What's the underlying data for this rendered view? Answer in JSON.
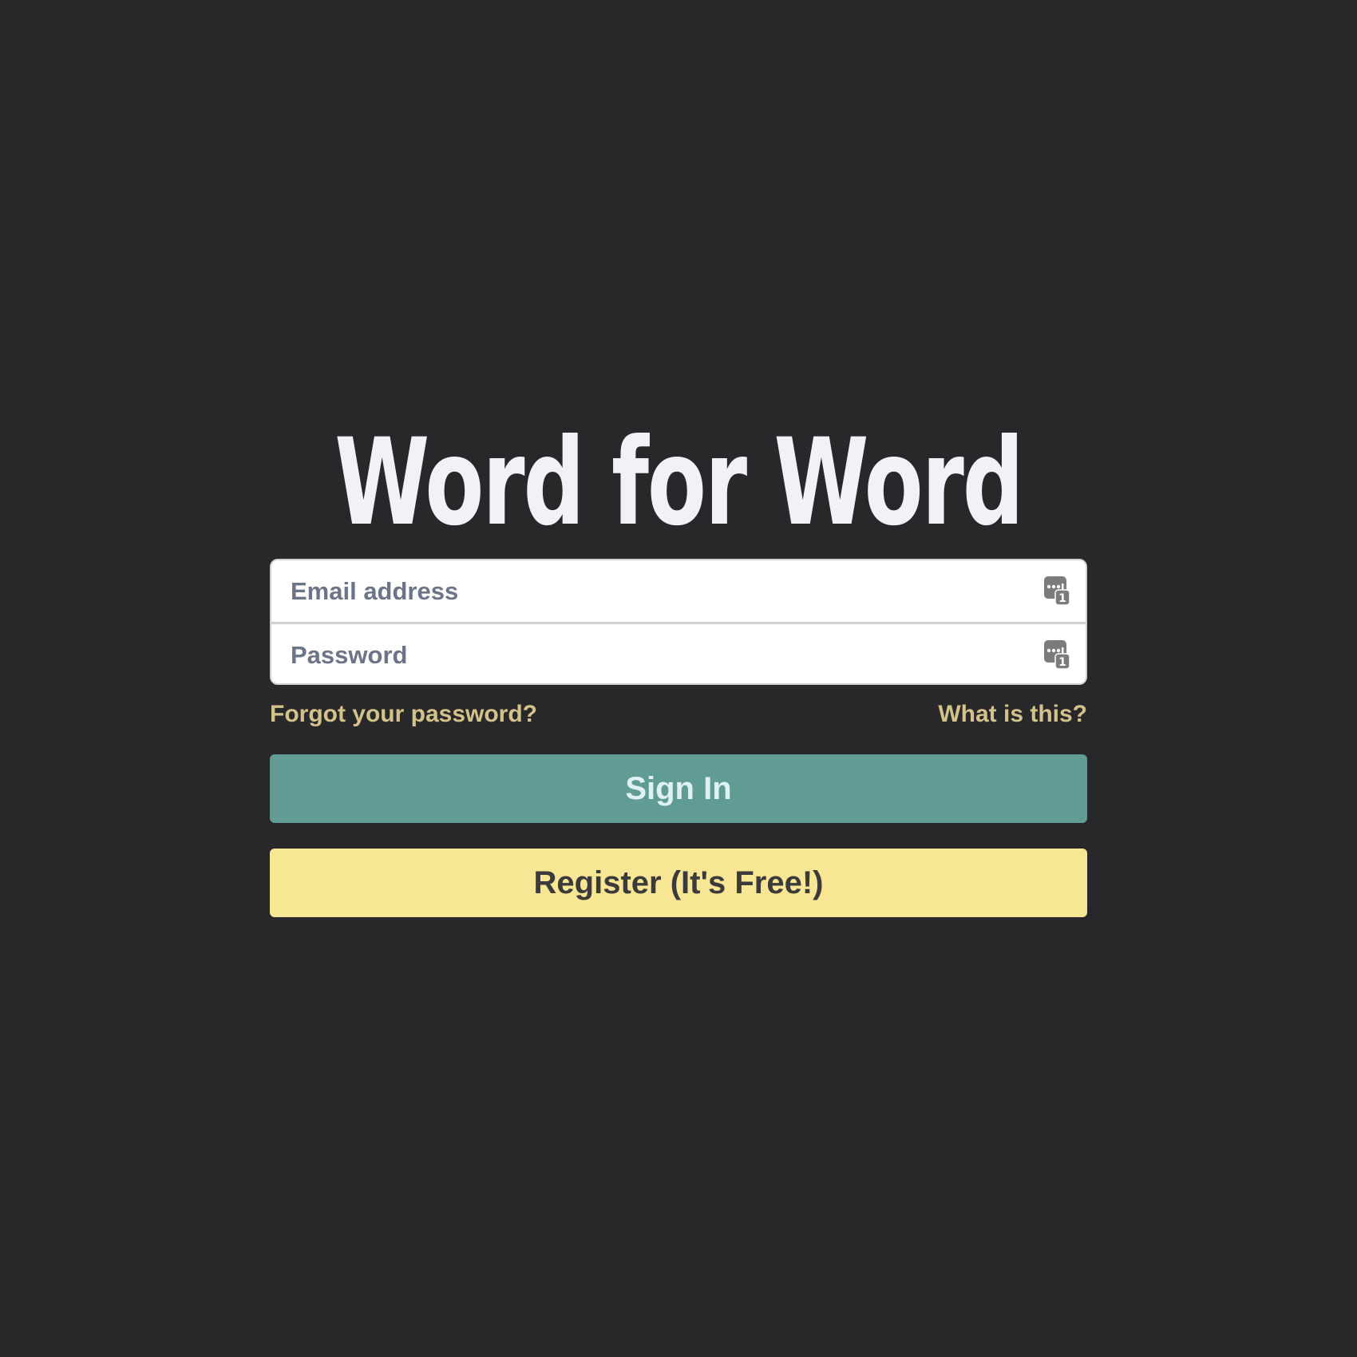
{
  "app": {
    "title": "Word for Word"
  },
  "login_form": {
    "email": {
      "placeholder": "Email address",
      "value": "",
      "icon": "password-manager-icon"
    },
    "password": {
      "placeholder": "Password",
      "value": "",
      "icon": "password-manager-icon",
      "icon_badge": "1"
    },
    "forgot_password_label": "Forgot your password?",
    "what_is_this_label": "What is this?",
    "sign_in_label": "Sign In",
    "register_label": "Register (It's Free!)"
  },
  "colors": {
    "background": "#28272a",
    "title": "#f1f2f7",
    "link": "#d3c38a",
    "sign_in_button": "#609c94",
    "register_button": "#f7e795"
  }
}
